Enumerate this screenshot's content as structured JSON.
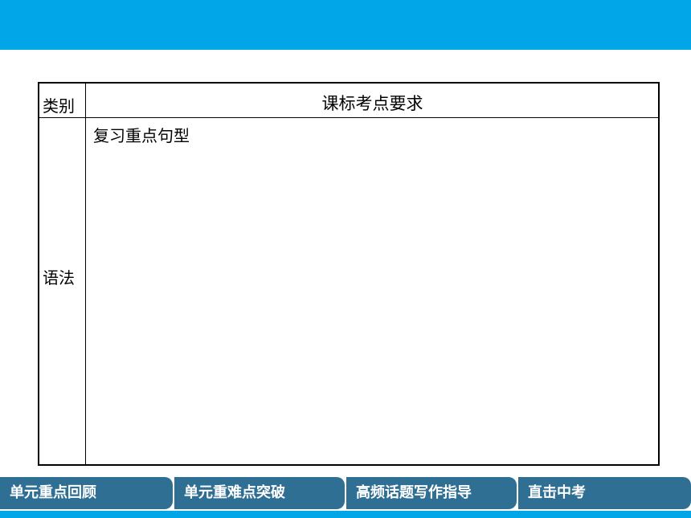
{
  "table": {
    "header_category": "类别",
    "header_requirement": "课标考点要求",
    "row_category": "语法",
    "row_content": "复习重点句型"
  },
  "nav": {
    "tabs": [
      "单元重点回顾",
      "单元重难点突破",
      "高频话题写作指导",
      "直击中考"
    ]
  },
  "colors": {
    "accent": "#00a6e8",
    "tab_bg": "#2f6f93",
    "tab_text": "#ffffff"
  }
}
